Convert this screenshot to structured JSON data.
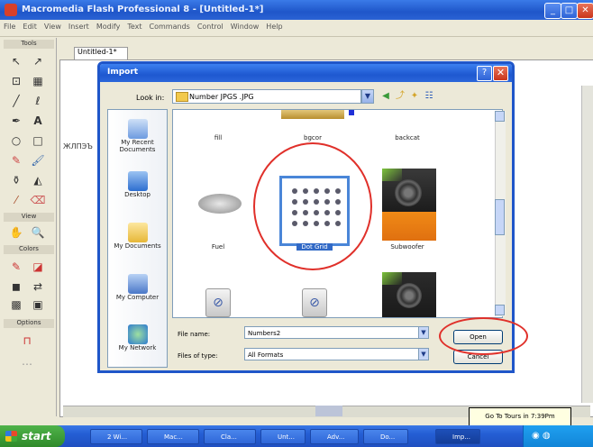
{
  "app": {
    "title": "Macromedia Flash Professional 8 - [Untitled-1*]",
    "menu": [
      "File",
      "Edit",
      "View",
      "Insert",
      "Modify",
      "Text",
      "Commands",
      "Control",
      "Window",
      "Help"
    ]
  },
  "tools": {
    "sections": [
      "Tools",
      "View",
      "Colors",
      "Options"
    ]
  },
  "document": {
    "tab": "Untitled-1*",
    "side_label": "ЖЛПЭЪ"
  },
  "dialog": {
    "title": "Import",
    "look_in_label": "Look in:",
    "look_in_value": "Number JPGS .JPG",
    "places": [
      "My Recent Documents",
      "Desktop",
      "My Documents",
      "My Computer",
      "My Network"
    ],
    "files": [
      {
        "name": "fill",
        "kind": "image"
      },
      {
        "name": "bgcor",
        "kind": "image"
      },
      {
        "name": "backcat",
        "kind": "image"
      },
      {
        "name": "Fuel",
        "kind": "image"
      },
      {
        "name": "Dot Grid",
        "kind": "image",
        "selected": true
      },
      {
        "name": "Subwoofer",
        "kind": "image"
      },
      {
        "name": "",
        "kind": "script"
      },
      {
        "name": "",
        "kind": "script"
      },
      {
        "name": "",
        "kind": "image"
      }
    ],
    "file_name_label": "File name:",
    "file_name_value": "Numbers2",
    "file_type_label": "Files of type:",
    "file_type_value": "All Formats",
    "open_button": "Open",
    "cancel_button": "Cancel"
  },
  "taskbar": {
    "start": "start",
    "tasks": [
      "2 Wi...",
      "Mac...",
      "Cla...",
      "Unt...",
      "Adv...",
      "Do...",
      "Imp..."
    ],
    "tooltip": "Go To Tours in 7:39Pm"
  },
  "colors": {
    "xp_blue": "#1f56c9",
    "annotation_red": "#e0302a",
    "selection": "#3169c6"
  }
}
